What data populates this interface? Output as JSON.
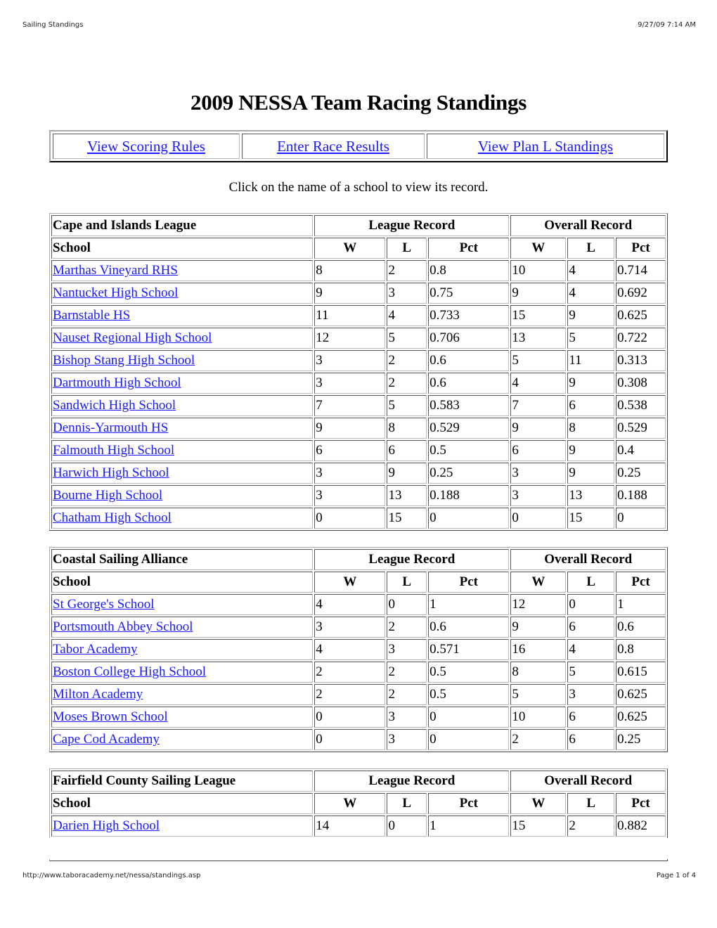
{
  "print_header": {
    "title": "Sailing Standings",
    "datetime": "9/27/09 7:14 AM"
  },
  "print_footer": {
    "url": "http://www.taboracademy.net/nessa/standings.asp",
    "page": "Page 1 of 4"
  },
  "page_title": "2009 NESSA Team Racing Standings",
  "nav": {
    "scoring_rules": "View Scoring Rules",
    "enter_results": "Enter Race Results",
    "plan_l": "View Plan L Standings"
  },
  "hint": "Click on the name of a school to view its record.",
  "headers": {
    "league_record": "League Record",
    "overall_record": "Overall Record",
    "school": "School",
    "w": "W",
    "l": "L",
    "pct": "Pct"
  },
  "leagues": [
    {
      "name": "Cape and Islands League",
      "rows": [
        {
          "school": "Marthas Vineyard RHS",
          "lw": "8",
          "ll": "2",
          "lp": "0.8",
          "ow": "10",
          "ol": "4",
          "op": "0.714"
        },
        {
          "school": "Nantucket High School",
          "lw": "9",
          "ll": "3",
          "lp": "0.75",
          "ow": "9",
          "ol": "4",
          "op": "0.692"
        },
        {
          "school": "Barnstable HS",
          "lw": "11",
          "ll": "4",
          "lp": "0.733",
          "ow": "15",
          "ol": "9",
          "op": "0.625"
        },
        {
          "school": "Nauset Regional High School",
          "lw": "12",
          "ll": "5",
          "lp": "0.706",
          "ow": "13",
          "ol": "5",
          "op": "0.722"
        },
        {
          "school": "Bishop Stang High School",
          "lw": "3",
          "ll": "2",
          "lp": "0.6",
          "ow": "5",
          "ol": "11",
          "op": "0.313"
        },
        {
          "school": "Dartmouth High School",
          "lw": "3",
          "ll": "2",
          "lp": "0.6",
          "ow": "4",
          "ol": "9",
          "op": "0.308"
        },
        {
          "school": "Sandwich High School",
          "lw": "7",
          "ll": "5",
          "lp": "0.583",
          "ow": "7",
          "ol": "6",
          "op": "0.538"
        },
        {
          "school": "Dennis-Yarmouth HS",
          "lw": "9",
          "ll": "8",
          "lp": "0.529",
          "ow": "9",
          "ol": "8",
          "op": "0.529"
        },
        {
          "school": "Falmouth High School",
          "lw": "6",
          "ll": "6",
          "lp": "0.5",
          "ow": "6",
          "ol": "9",
          "op": "0.4"
        },
        {
          "school": "Harwich High School",
          "lw": "3",
          "ll": "9",
          "lp": "0.25",
          "ow": "3",
          "ol": "9",
          "op": "0.25"
        },
        {
          "school": "Bourne High School",
          "lw": "3",
          "ll": "13",
          "lp": "0.188",
          "ow": "3",
          "ol": "13",
          "op": "0.188"
        },
        {
          "school": "Chatham High School",
          "lw": "0",
          "ll": "15",
          "lp": "0",
          "ow": "0",
          "ol": "15",
          "op": "0"
        }
      ]
    },
    {
      "name": "Coastal Sailing Alliance",
      "rows": [
        {
          "school": "St George's School",
          "lw": "4",
          "ll": "0",
          "lp": "1",
          "ow": "12",
          "ol": "0",
          "op": "1"
        },
        {
          "school": "Portsmouth Abbey School",
          "lw": "3",
          "ll": "2",
          "lp": "0.6",
          "ow": "9",
          "ol": "6",
          "op": "0.6"
        },
        {
          "school": "Tabor Academy",
          "lw": "4",
          "ll": "3",
          "lp": "0.571",
          "ow": "16",
          "ol": "4",
          "op": "0.8"
        },
        {
          "school": "Boston College High School",
          "lw": "2",
          "ll": "2",
          "lp": "0.5",
          "ow": "8",
          "ol": "5",
          "op": "0.615"
        },
        {
          "school": "Milton Academy",
          "lw": "2",
          "ll": "2",
          "lp": "0.5",
          "ow": "5",
          "ol": "3",
          "op": "0.625"
        },
        {
          "school": "Moses Brown School",
          "lw": "0",
          "ll": "3",
          "lp": "0",
          "ow": "10",
          "ol": "6",
          "op": "0.625"
        },
        {
          "school": "Cape Cod Academy",
          "lw": "0",
          "ll": "3",
          "lp": "0",
          "ow": "2",
          "ol": "6",
          "op": "0.25"
        }
      ]
    },
    {
      "name": "Fairfield County Sailing League",
      "rows": [
        {
          "school": "Darien High School",
          "lw": "14",
          "ll": "0",
          "lp": "1",
          "ow": "15",
          "ol": "2",
          "op": "0.882"
        }
      ]
    }
  ]
}
